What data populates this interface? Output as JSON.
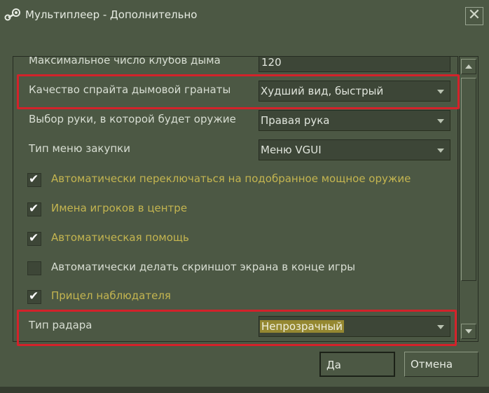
{
  "window": {
    "title": "Мультиплеер - Дополнительно",
    "app_icon": "steam-icon",
    "close_glyph": "✕"
  },
  "settings": {
    "smoke_clubs": {
      "label": "Максимальное число клубов дыма",
      "value": "120"
    },
    "smoke_quality": {
      "label": "Качество спрайта дымовой гранаты",
      "value": "Худший вид, быстрый"
    },
    "hand": {
      "label": "Выбор руки, в которой будет оружие",
      "value": "Правая рука"
    },
    "buy_menu": {
      "label": "Тип меню закупки",
      "value": "Меню VGUI"
    },
    "radar": {
      "label": "Тип радара",
      "value": "Непрозрачный"
    }
  },
  "checkboxes": [
    {
      "label": "Автоматически переключаться на подобранное мощное оружие",
      "checked": true
    },
    {
      "label": "Имена игроков в центре",
      "checked": true
    },
    {
      "label": "Автоматическая помощь",
      "checked": true
    },
    {
      "label": "Автоматически делать скриншот экрана в конце игры",
      "checked": false
    },
    {
      "label": "Прицел наблюдателя",
      "checked": true
    }
  ],
  "check_glyph": "✔",
  "buttons": {
    "ok": "Да",
    "cancel": "Отмена"
  },
  "colors": {
    "background": "#4c5844",
    "checked_label": "#c4b550",
    "highlight": "#d3222a",
    "selection": "#958831"
  }
}
